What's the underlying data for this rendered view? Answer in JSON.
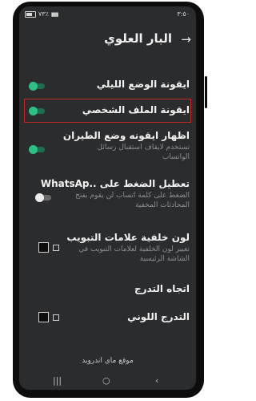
{
  "status_bar": {
    "time": "٣:٥٠",
    "battery": "٧٣٪"
  },
  "header": {
    "title": "البار العلوي",
    "back_icon": "back-arrow-icon"
  },
  "settings": [
    {
      "title": "ايقونة الوضع الليلي",
      "subtitle": "",
      "control": "toggle",
      "state": "on"
    },
    {
      "title": "ايقونة الملف الشخصي",
      "subtitle": "",
      "control": "toggle",
      "state": "on",
      "highlighted": true
    },
    {
      "title": "اظهار ايقونه وضع الطيران",
      "subtitle": "تستخدم لايقاف استقبال رسائل الواتساب",
      "control": "toggle",
      "state": "on"
    },
    {
      "title": "تعطيل الضغط على ..WhatsAp",
      "subtitle": "الضغط على كلمة اتساب لن يقوم بفتح المحادثات المخفية",
      "control": "toggle",
      "state": "off"
    },
    {
      "title": "لون خلفية علامات التبويب",
      "subtitle": "تغيير لون الخلفية لعلامات التبويب في الشاشة الرئيسية",
      "control": "color",
      "swatch_color": "#0d0d0d"
    },
    {
      "title": "اتجاه التدرج",
      "subtitle": "",
      "control": "none"
    },
    {
      "title": "التدرج اللوني",
      "subtitle": "",
      "control": "color",
      "swatch_color": "#0d0d0d"
    }
  ],
  "footer": {
    "text": "موقع ماي اندرويد"
  },
  "nav_bar": {
    "recent": "|||",
    "home": "○",
    "back": "‹"
  },
  "colors": {
    "background": "#2b2c2e",
    "accent_green": "#2fbf85",
    "highlight_red": "#c3272b"
  }
}
